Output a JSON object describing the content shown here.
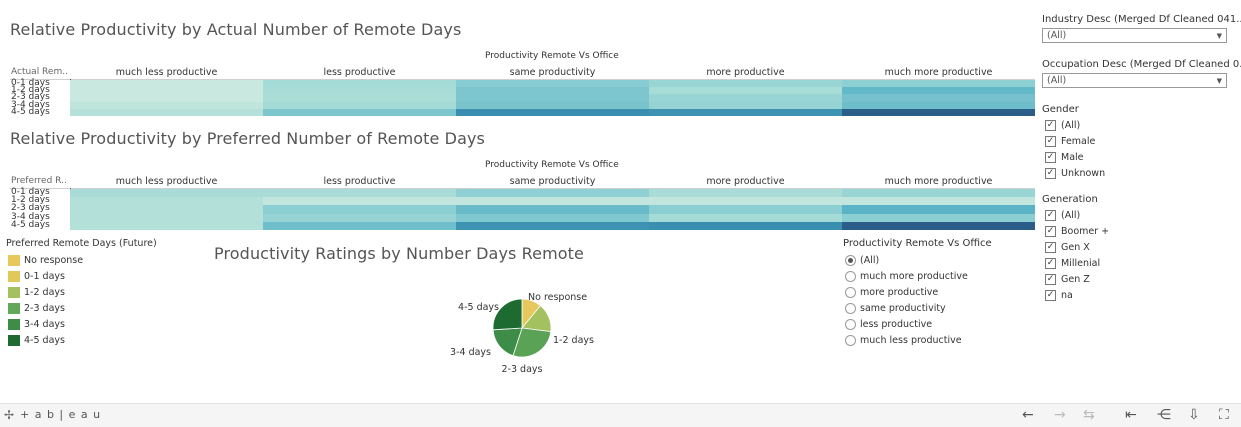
{
  "heatmap1": {
    "title": "Relative Productivity by Actual Number of Remote Days",
    "col_title": "Productivity Remote Vs Office",
    "row_header": "Actual Rem..",
    "columns": [
      "much less productive",
      "less productive",
      "same productivity",
      "more productive",
      "much more productive"
    ],
    "rows": [
      "0-1 days",
      "1-2 days",
      "2-3 days",
      "3-4 days",
      "4-5 days"
    ],
    "colors": [
      [
        "#c9e9e0",
        "#a5dbd6",
        "#87ccd2",
        "#9ad5d5",
        "#8dd0d4"
      ],
      [
        "#c9e9e0",
        "#a8dcd6",
        "#7dc5cf",
        "#a8dcd6",
        "#62b9c9"
      ],
      [
        "#c9e9e0",
        "#abddd7",
        "#7dc5cf",
        "#9ad5d5",
        "#76c1cd"
      ],
      [
        "#bfe5dd",
        "#a5dbd6",
        "#79c3cd",
        "#95d3d4",
        "#6ebdcb"
      ],
      [
        "#b5e1da",
        "#7ec6ce",
        "#3a8fb0",
        "#3e93b2",
        "#2a5d88"
      ]
    ]
  },
  "heatmap2": {
    "title": "Relative Productivity by Preferred Number of Remote Days",
    "col_title": "Productivity Remote Vs Office",
    "row_header": "Preferred R..",
    "columns": [
      "much less productive",
      "less productive",
      "same productivity",
      "more productive",
      "much more productive"
    ],
    "rows": [
      "0-1 days",
      "1-2 days",
      "2-3 days",
      "3-4 days",
      "4-5 days"
    ],
    "colors": [
      [
        "#a9dcd6",
        "#a9dcd6",
        "#8fd0d4",
        "#a9dcd6",
        "#9ad5d5"
      ],
      [
        "#b3e0d9",
        "#c2e6de",
        "#c2e6de",
        "#c2e6de",
        "#c2e6de"
      ],
      [
        "#b3e0d9",
        "#8bcfd2",
        "#6abbca",
        "#8bcfd2",
        "#5ab3c7"
      ],
      [
        "#b3e0d9",
        "#95d3d4",
        "#80c8cf",
        "#a5dbd6",
        "#8bcfd2"
      ],
      [
        "#b3e0d9",
        "#6fbecb",
        "#3f93b2",
        "#3a8fb0",
        "#2a5d88"
      ]
    ]
  },
  "legend": {
    "title": "Preferred Remote Days (Future)",
    "items": [
      {
        "label": "No response",
        "color": "#e8c75c"
      },
      {
        "label": "0-1 days",
        "color": "#e0c85a"
      },
      {
        "label": "1-2 days",
        "color": "#a3c15e"
      },
      {
        "label": "2-3 days",
        "color": "#62a85a"
      },
      {
        "label": "3-4 days",
        "color": "#3d8c48"
      },
      {
        "label": "4-5 days",
        "color": "#1e6b32"
      }
    ]
  },
  "pie": {
    "title": "Productivity Ratings by Number Days Remote",
    "slices": [
      {
        "label": "No response",
        "value": 11,
        "color": "#e6c85e"
      },
      {
        "label": "1-2 days",
        "value": 16,
        "color": "#a3c15e"
      },
      {
        "label": "2-3 days",
        "value": 28,
        "color": "#5aa356"
      },
      {
        "label": "3-4 days",
        "value": 19,
        "color": "#3d8c48"
      },
      {
        "label": "4-5 days",
        "value": 26,
        "color": "#1e6b32"
      }
    ]
  },
  "radio_filter": {
    "title": "Productivity Remote Vs Office",
    "options": [
      "(All)",
      "much more productive",
      "more productive",
      "same productivity",
      "less productive",
      "much less productive"
    ],
    "selected": "(All)"
  },
  "filters": {
    "industry": {
      "label": "Industry Desc (Merged Df Cleaned 041...",
      "value": "(All)"
    },
    "occupation": {
      "label": "Occupation Desc (Merged Df Cleaned 0...",
      "value": "(All)"
    },
    "gender": {
      "label": "Gender",
      "options": [
        "(All)",
        "Female",
        "Male",
        "Unknown"
      ]
    },
    "generation": {
      "label": "Generation",
      "options": [
        "(All)",
        "Boomer +",
        "Gen X",
        "Millenial",
        "Gen Z",
        "na"
      ]
    }
  },
  "footer": {
    "brand": "+ a b | e a u",
    "icons": [
      "undo-icon",
      "redo-icon",
      "revert-icon",
      "first-icon",
      "share-icon",
      "download-icon",
      "fullscreen-icon"
    ]
  }
}
